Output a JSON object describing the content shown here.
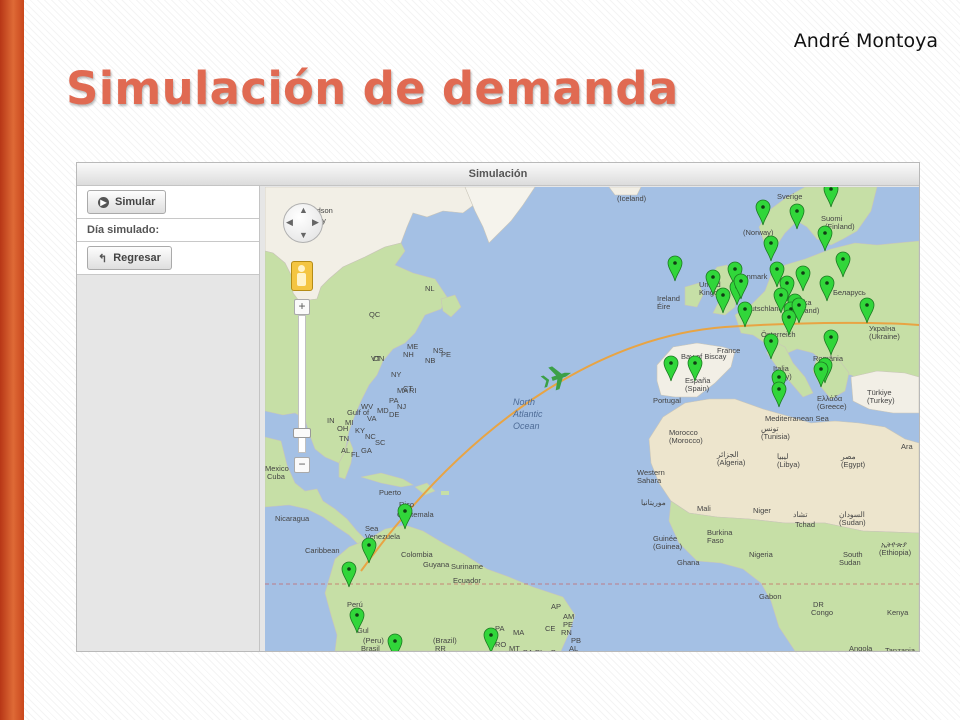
{
  "slide": {
    "author": "André Montoya",
    "title": "Simulación de demanda"
  },
  "app": {
    "header_title": "Simulación",
    "sidebar": {
      "simulate_button": "Simular",
      "simulated_day_label": "Día simulado:",
      "back_button": "Regresar"
    }
  },
  "map": {
    "ocean_label": [
      "North",
      "Atlantic",
      "Ocean"
    ],
    "place_labels": [
      {
        "name": "(Iceland)"
      },
      {
        "name": "Sverige"
      },
      {
        "name": "Suomi"
      },
      {
        "name": "(Finland)"
      },
      {
        "name": "(Norway)"
      },
      {
        "name": "Danmark"
      },
      {
        "name": "United"
      },
      {
        "name": "Kingdom"
      },
      {
        "name": "Ireland"
      },
      {
        "name": "Éire"
      },
      {
        "name": "Deutschland"
      },
      {
        "name": "Polska"
      },
      {
        "name": "(Poland)"
      },
      {
        "name": "Беларусь"
      },
      {
        "name": "France"
      },
      {
        "name": "Österreich"
      },
      {
        "name": "Україна"
      },
      {
        "name": "(Ukraine)"
      },
      {
        "name": "România"
      },
      {
        "name": "Italia"
      },
      {
        "name": "(Italy)"
      },
      {
        "name": "España"
      },
      {
        "name": "(Spain)"
      },
      {
        "name": "Portugal"
      },
      {
        "name": "Ελλάδα"
      },
      {
        "name": "(Greece)"
      },
      {
        "name": "Türkiye"
      },
      {
        "name": "(Turkey)"
      },
      {
        "name": "Mediterranean Sea"
      },
      {
        "name": "Bay of Biscay"
      },
      {
        "name": "Morocco"
      },
      {
        "name": "(Morocco)"
      },
      {
        "name": "الجزائر"
      },
      {
        "name": "(Algeria)"
      },
      {
        "name": "ليبيا"
      },
      {
        "name": "(Libya)"
      },
      {
        "name": "مصر"
      },
      {
        "name": "(Egypt)"
      },
      {
        "name": "تونس"
      },
      {
        "name": "(Tunisia)"
      },
      {
        "name": "Western"
      },
      {
        "name": "Sahara"
      },
      {
        "name": "موريتانيا"
      },
      {
        "name": "Mali"
      },
      {
        "name": "Niger"
      },
      {
        "name": "Tchad"
      },
      {
        "name": "تشاد"
      },
      {
        "name": "السودان"
      },
      {
        "name": "(Sudan)"
      },
      {
        "name": "Burkina"
      },
      {
        "name": "Faso"
      },
      {
        "name": "Nigeria"
      },
      {
        "name": "Guinée"
      },
      {
        "name": "(Guinea)"
      },
      {
        "name": "Ghana"
      },
      {
        "name": "Gabon"
      },
      {
        "name": "DR"
      },
      {
        "name": "Congo"
      },
      {
        "name": "South"
      },
      {
        "name": "Sudan"
      },
      {
        "name": "ኢትዮጵያ"
      },
      {
        "name": "(Ethiopia)"
      },
      {
        "name": "Kenya"
      },
      {
        "name": "Angola"
      },
      {
        "name": "Tanzania"
      },
      {
        "name": "Mozamb"
      },
      {
        "name": "Hudson"
      },
      {
        "name": "Bay"
      },
      {
        "name": "QC"
      },
      {
        "name": "NL"
      },
      {
        "name": "PE"
      },
      {
        "name": "NS"
      },
      {
        "name": "NB"
      },
      {
        "name": "ON"
      },
      {
        "name": "VT"
      },
      {
        "name": "NH"
      },
      {
        "name": "ME"
      },
      {
        "name": "NY"
      },
      {
        "name": "MA"
      },
      {
        "name": "CT"
      },
      {
        "name": "RI"
      },
      {
        "name": "PA"
      },
      {
        "name": "NJ"
      },
      {
        "name": "DE"
      },
      {
        "name": "MD"
      },
      {
        "name": "VA"
      },
      {
        "name": "WV"
      },
      {
        "name": "KY"
      },
      {
        "name": "NC"
      },
      {
        "name": "SC"
      },
      {
        "name": "GA"
      },
      {
        "name": "FL"
      },
      {
        "name": "AL"
      },
      {
        "name": "TN"
      },
      {
        "name": "MI"
      },
      {
        "name": "IN"
      },
      {
        "name": "OH"
      },
      {
        "name": "Gulf of"
      },
      {
        "name": "Mexico"
      },
      {
        "name": "Cuba"
      },
      {
        "name": "Puerto"
      },
      {
        "name": "Rico"
      },
      {
        "name": "Guatemala"
      },
      {
        "name": "Nicaragua"
      },
      {
        "name": "Caribbean"
      },
      {
        "name": "Sea"
      },
      {
        "name": "Venezuela"
      },
      {
        "name": "Colombia"
      },
      {
        "name": "Guyana"
      },
      {
        "name": "Suriname"
      },
      {
        "name": "Ecuador"
      },
      {
        "name": "Perú"
      },
      {
        "name": "(Peru)"
      },
      {
        "name": "Brasil"
      },
      {
        "name": "(Brazil)"
      },
      {
        "name": "RR"
      },
      {
        "name": "AP"
      },
      {
        "name": "AM"
      },
      {
        "name": "PA"
      },
      {
        "name": "MA"
      },
      {
        "name": "CE"
      },
      {
        "name": "RN"
      },
      {
        "name": "PB"
      },
      {
        "name": "PE"
      },
      {
        "name": "AL"
      },
      {
        "name": "RO"
      },
      {
        "name": "MT"
      },
      {
        "name": "TO"
      },
      {
        "name": "BA"
      },
      {
        "name": "PI"
      },
      {
        "name": "Bay"
      },
      {
        "name": "Gul"
      },
      {
        "name": "Ara"
      }
    ],
    "colors": {
      "ocean": "#a4c0e4",
      "land": "#f2efe6",
      "vegetation": "#c6dfa6",
      "desert": "#ede5cd",
      "marker": "#31d63a",
      "route": "#e8a444",
      "plane": "#3ba047"
    },
    "controls": {
      "pan": "pan-control",
      "pegman": "pegman-icon",
      "zoom_in": "+",
      "zoom_out": "−"
    }
  }
}
